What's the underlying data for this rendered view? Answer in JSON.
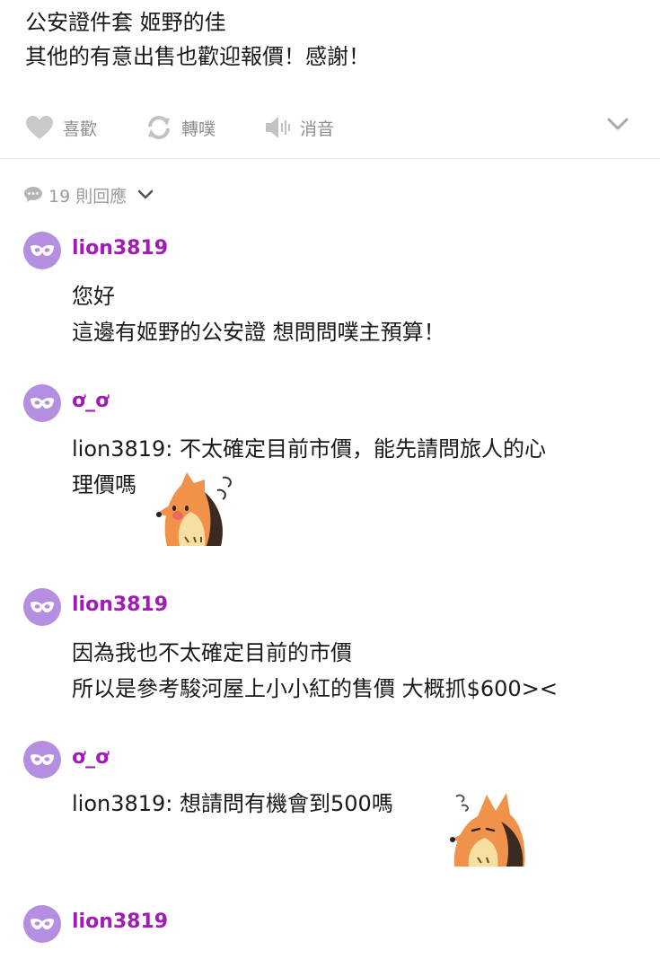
{
  "post": {
    "lines": [
      "公安證件套 姬野的佳",
      "其他的有意出售也歡迎報價！感謝！"
    ]
  },
  "actions": {
    "like_label": "喜歡",
    "replurk_label": "轉噗",
    "mute_label": "消音"
  },
  "replies": {
    "count_label": "19 則回應"
  },
  "colors": {
    "username": "#a21ab7",
    "avatar_bg": "#b48ee0",
    "muted_text": "#8d8d8d"
  },
  "comments": [
    {
      "user": "lion3819",
      "lines": [
        "您好",
        "這邊有姬野的公安證 想問問噗主預算！"
      ]
    },
    {
      "user": "ơ_ơ",
      "lines": [
        "lion3819: 不太確定目前市價，能先請問旅人的心",
        "理價嗎"
      ],
      "sticker": "fox-sweating-sticker"
    },
    {
      "user": "lion3819",
      "lines": [
        "因為我也不太確定目前的市價",
        "所以是參考駿河屋上小小紅的售價 大概抓$600><"
      ]
    },
    {
      "user": "ơ_ơ",
      "lines": [
        "lion3819: 想請問有機會到500嗎"
      ],
      "sticker": "fox-tired-sticker"
    },
    {
      "user": "lion3819",
      "lines": []
    }
  ]
}
